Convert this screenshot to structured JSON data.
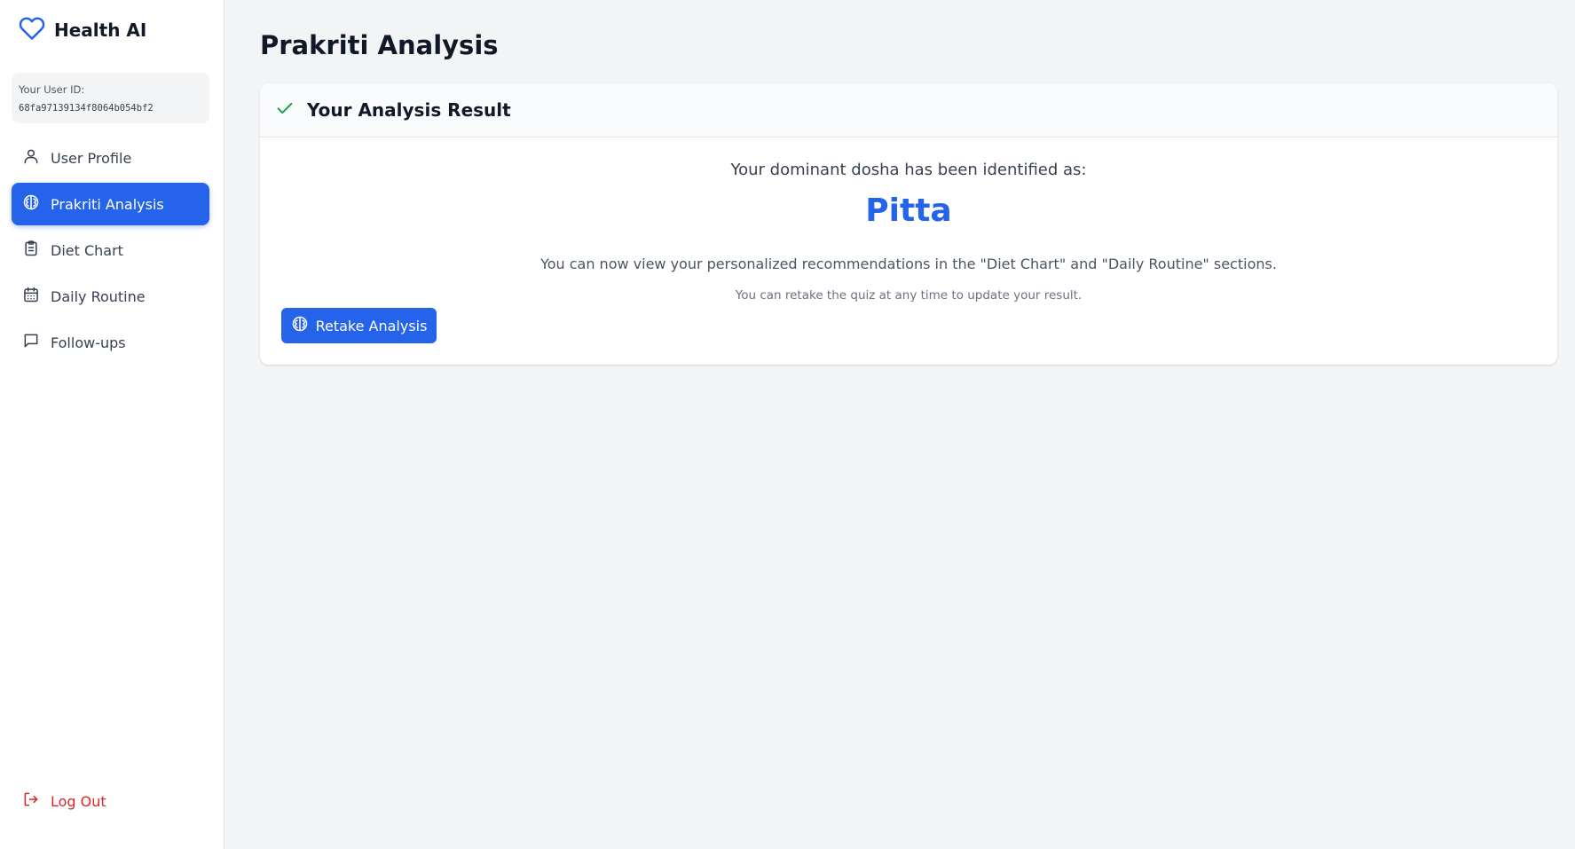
{
  "app": {
    "name": "Health AI",
    "brand_color": "#2563eb"
  },
  "sidebar": {
    "user_id_label": "Your User ID:",
    "user_id_value": "68fa97139134f8064b054bf2",
    "items": [
      {
        "label": "User Profile",
        "icon": "user-icon",
        "active": false
      },
      {
        "label": "Prakriti Analysis",
        "icon": "brain-icon",
        "active": true
      },
      {
        "label": "Diet Chart",
        "icon": "clipboard-icon",
        "active": false
      },
      {
        "label": "Daily Routine",
        "icon": "calendar-icon",
        "active": false
      },
      {
        "label": "Follow-ups",
        "icon": "message-icon",
        "active": false
      }
    ],
    "logout_label": "Log Out"
  },
  "main": {
    "page_title": "Prakriti Analysis",
    "card": {
      "title": "Your Analysis Result",
      "dominant_text": "Your dominant dosha has been identified as:",
      "dosha": "Pitta",
      "recommend_text": "You can now view your personalized recommendations in the \"Diet Chart\" and \"Daily Routine\" sections.",
      "retake_note": "You can retake the quiz at any time to update your result.",
      "retake_button": "Retake Analysis"
    }
  },
  "colors": {
    "accent": "#2563eb",
    "success": "#16a34a",
    "danger": "#dc2626"
  }
}
